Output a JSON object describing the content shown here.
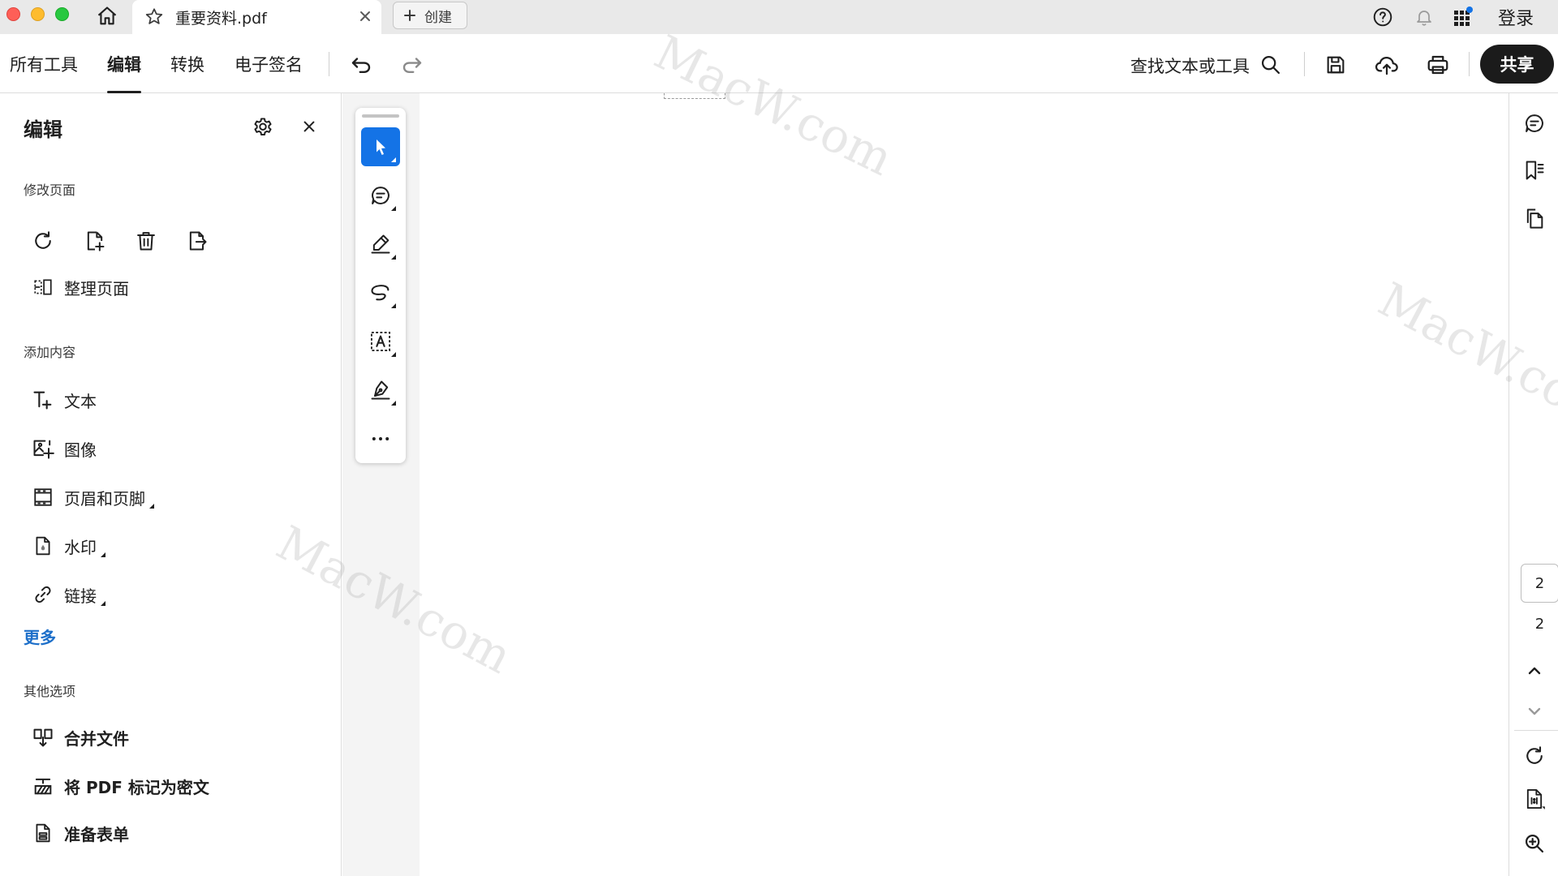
{
  "window": {
    "home_icon": "home-icon",
    "tab": {
      "title": "重要资料.pdf",
      "star_icon": "star-icon",
      "close_icon": "close-icon"
    },
    "create_button": {
      "label": "创建",
      "icon": "plus-icon"
    },
    "right": {
      "help_icon": "help-icon",
      "bell_icon": "bell-icon",
      "apps_icon": "apps-grid-icon",
      "signin_label": "登录"
    }
  },
  "toolbar": {
    "tabs": [
      {
        "label": "所有工具",
        "active": false
      },
      {
        "label": "编辑",
        "active": true
      },
      {
        "label": "转换",
        "active": false
      },
      {
        "label": "电子签名",
        "active": false
      }
    ],
    "undo_icon": "undo-icon",
    "redo_icon": "redo-icon",
    "find_label": "查找文本或工具",
    "find_icon": "search-icon",
    "save_icon": "save-icon",
    "upload_icon": "cloud-upload-icon",
    "print_icon": "print-icon",
    "share_label": "共享"
  },
  "edit_panel": {
    "title": "编辑",
    "sections": {
      "modify_pages": {
        "label": "修改页面",
        "tools": [
          "rotate-page-icon",
          "insert-page-icon",
          "delete-page-icon",
          "extract-page-icon"
        ],
        "organize_label": "整理页面"
      },
      "add_content": {
        "label": "添加内容",
        "items": [
          {
            "label": "文本",
            "icon": "add-text-icon"
          },
          {
            "label": "图像",
            "icon": "add-image-icon"
          },
          {
            "label": "页眉和页脚",
            "icon": "header-footer-icon"
          },
          {
            "label": "水印",
            "icon": "watermark-icon"
          },
          {
            "label": "链接",
            "icon": "link-icon"
          }
        ],
        "more_label": "更多"
      },
      "other_options": {
        "label": "其他选项",
        "items": [
          {
            "label": "合并文件",
            "icon": "combine-files-icon"
          },
          {
            "label": "将 PDF 标记为密文",
            "icon": "redact-icon"
          },
          {
            "label": "准备表单",
            "icon": "prepare-form-icon"
          }
        ]
      }
    }
  },
  "floating_tools": {
    "items": [
      "select-cursor-icon",
      "comment-icon",
      "highlight-icon",
      "freehand-draw-icon",
      "text-box-icon",
      "sign-pen-icon",
      "more-icon"
    ],
    "selected": "select-cursor-icon"
  },
  "right_rail": {
    "current_page": "2",
    "total_pages": "2"
  },
  "watermark_text": "MacW.com",
  "colors": {
    "accent": "#1473e6",
    "link": "#1d6fc9",
    "share_bg": "#1b1b1b"
  }
}
